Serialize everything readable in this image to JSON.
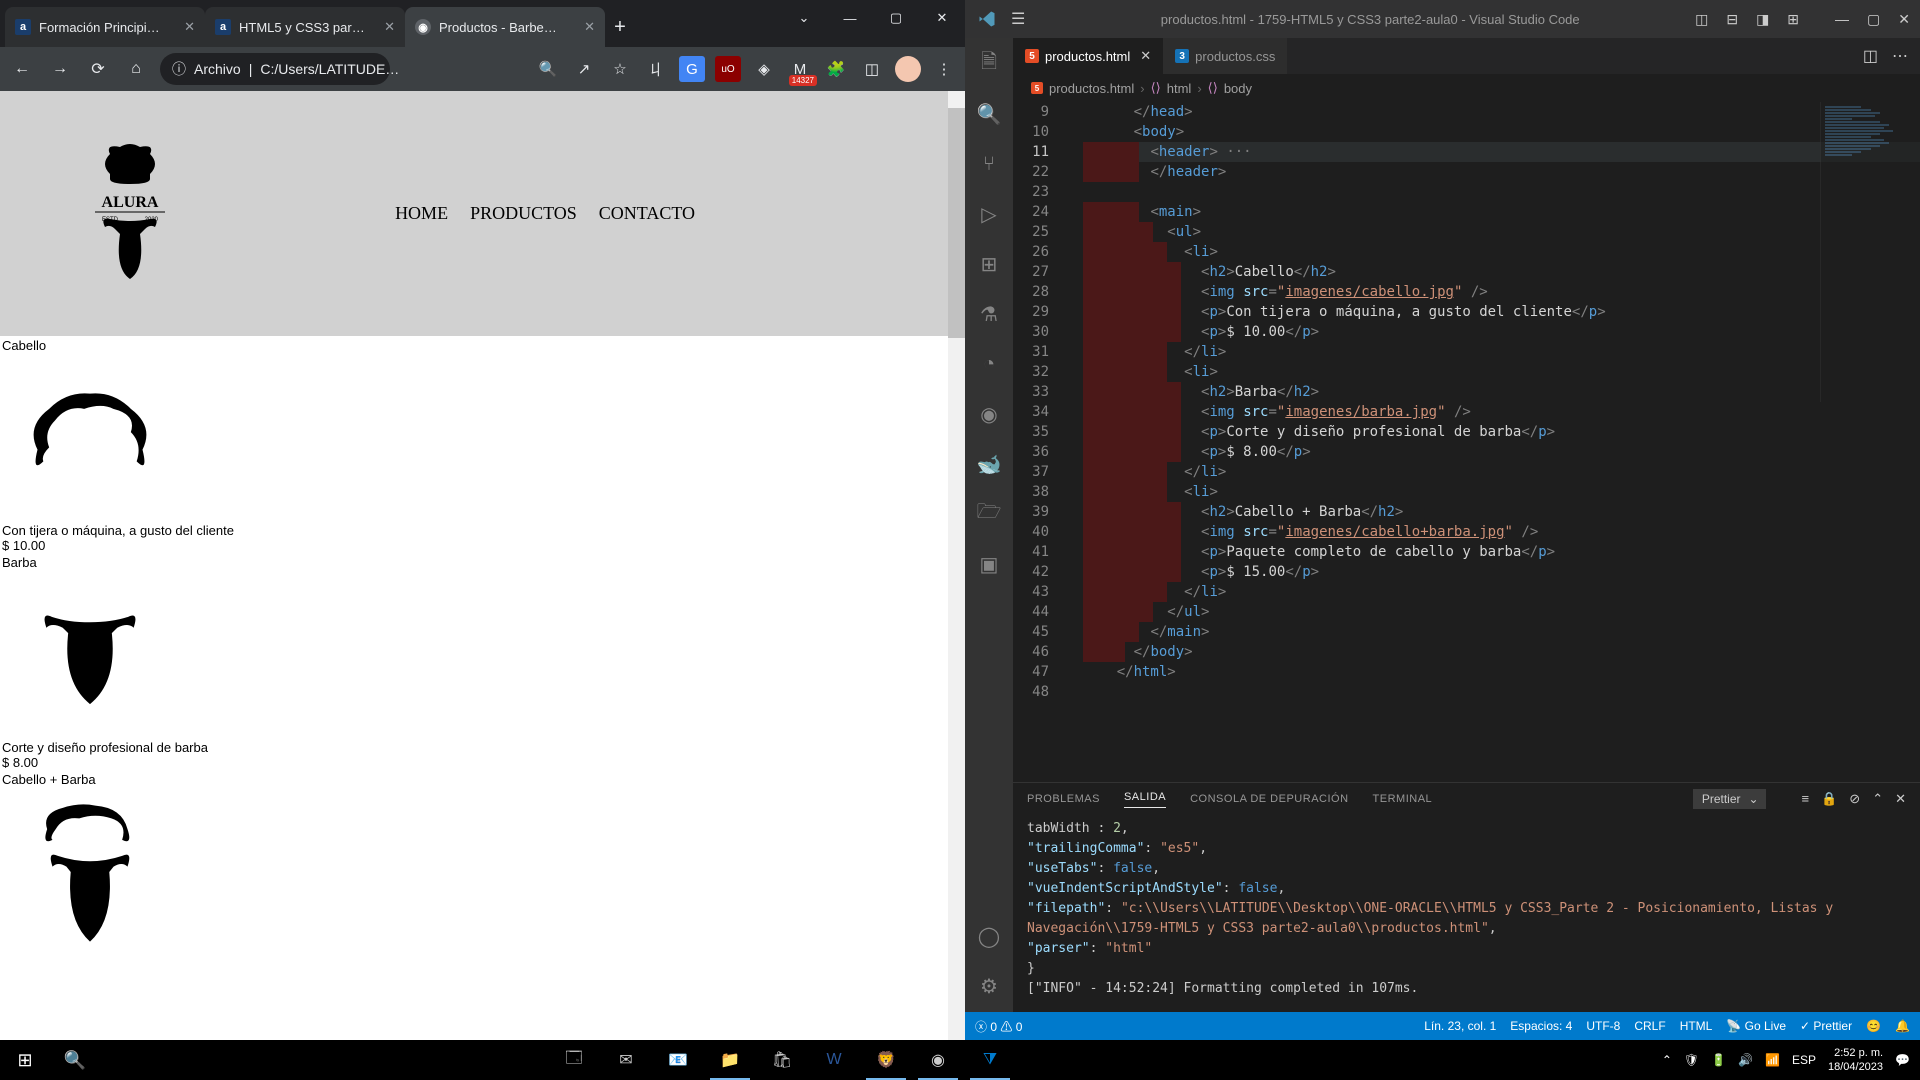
{
  "browser": {
    "tabs": [
      {
        "title": "Formación Principi…",
        "favicon": "a"
      },
      {
        "title": "HTML5 y CSS3 par…",
        "favicon": "a"
      },
      {
        "title": "Productos - Barbe…",
        "favicon": "◉",
        "active": true
      }
    ],
    "url_prefix": "Archivo",
    "url_path": "C:/Users/LATITUDE…",
    "gmail_badge": "14327",
    "page": {
      "nav": [
        "HOME",
        "PRODUCTOS",
        "CONTACTO"
      ],
      "logo_text_top": "ALURA",
      "logo_text_sub": "ESTD          2020",
      "products": [
        {
          "title": "Cabello",
          "desc": "Con tijera o máquina, a gusto del cliente",
          "price": "$ 10.00"
        },
        {
          "title": "Barba",
          "desc": "Corte y diseño profesional de barba",
          "price": "$ 8.00"
        },
        {
          "title": "Cabello + Barba"
        }
      ]
    }
  },
  "vscode": {
    "title": "productos.html - 1759-HTML5 y CSS3 parte2-aula0 - Visual Studio Code",
    "tabs": [
      {
        "name": "productos.html",
        "active": true,
        "type": "html5"
      },
      {
        "name": "productos.css",
        "active": false,
        "type": "css3"
      }
    ],
    "breadcrumb": [
      "productos.html",
      "html",
      "body"
    ],
    "lines": {
      "9": {
        "indent": 3,
        "html": "<span class='c-tag'>&lt;/</span><span class='c-name'>head</span><span class='c-tag'>&gt;</span>"
      },
      "10": {
        "indent": 3,
        "html": "<span class='c-tag'>&lt;</span><span class='c-name'>body</span><span class='c-tag'>&gt;</span>"
      },
      "11": {
        "indent": 4,
        "html": "<span class='c-tag'>&lt;</span><span class='c-name'>header</span><span class='c-tag'>&gt;</span> <span class='c-dots'>···</span>",
        "hl": true,
        "fold": true
      },
      "22": {
        "indent": 4,
        "html": "<span class='c-tag'>&lt;/</span><span class='c-name'>header</span><span class='c-tag'>&gt;</span>"
      },
      "23": {
        "indent": 0,
        "html": ""
      },
      "24": {
        "indent": 4,
        "html": "<span class='c-tag'>&lt;</span><span class='c-name'>main</span><span class='c-tag'>&gt;</span>"
      },
      "25": {
        "indent": 5,
        "html": "<span class='c-tag'>&lt;</span><span class='c-name'>ul</span><span class='c-tag'>&gt;</span>"
      },
      "26": {
        "indent": 6,
        "html": "<span class='c-tag'>&lt;</span><span class='c-name'>li</span><span class='c-tag'>&gt;</span>"
      },
      "27": {
        "indent": 7,
        "html": "<span class='c-tag'>&lt;</span><span class='c-name'>h2</span><span class='c-tag'>&gt;</span><span class='c-txt'>Cabello</span><span class='c-tag'>&lt;/</span><span class='c-name'>h2</span><span class='c-tag'>&gt;</span>"
      },
      "28": {
        "indent": 7,
        "html": "<span class='c-tag'>&lt;</span><span class='c-name'>img</span> <span class='c-attr'>src</span><span class='c-tag'>=</span><span class='c-str'>\"</span><span class='c-link'>imagenes/cabello.jpg</span><span class='c-str'>\"</span> <span class='c-tag'>/&gt;</span>"
      },
      "29": {
        "indent": 7,
        "html": "<span class='c-tag'>&lt;</span><span class='c-name'>p</span><span class='c-tag'>&gt;</span><span class='c-txt'>Con tijera o máquina, a gusto del cliente</span><span class='c-tag'>&lt;/</span><span class='c-name'>p</span><span class='c-tag'>&gt;</span>"
      },
      "30": {
        "indent": 7,
        "html": "<span class='c-tag'>&lt;</span><span class='c-name'>p</span><span class='c-tag'>&gt;</span><span class='c-txt'>$ 10.00</span><span class='c-tag'>&lt;/</span><span class='c-name'>p</span><span class='c-tag'>&gt;</span>"
      },
      "31": {
        "indent": 6,
        "html": "<span class='c-tag'>&lt;/</span><span class='c-name'>li</span><span class='c-tag'>&gt;</span>"
      },
      "32": {
        "indent": 6,
        "html": "<span class='c-tag'>&lt;</span><span class='c-name'>li</span><span class='c-tag'>&gt;</span>"
      },
      "33": {
        "indent": 7,
        "html": "<span class='c-tag'>&lt;</span><span class='c-name'>h2</span><span class='c-tag'>&gt;</span><span class='c-txt'>Barba</span><span class='c-tag'>&lt;/</span><span class='c-name'>h2</span><span class='c-tag'>&gt;</span>"
      },
      "34": {
        "indent": 7,
        "html": "<span class='c-tag'>&lt;</span><span class='c-name'>img</span> <span class='c-attr'>src</span><span class='c-tag'>=</span><span class='c-str'>\"</span><span class='c-link'>imagenes/barba.jpg</span><span class='c-str'>\"</span> <span class='c-tag'>/&gt;</span>"
      },
      "35": {
        "indent": 7,
        "html": "<span class='c-tag'>&lt;</span><span class='c-name'>p</span><span class='c-tag'>&gt;</span><span class='c-txt'>Corte y diseño profesional de barba</span><span class='c-tag'>&lt;/</span><span class='c-name'>p</span><span class='c-tag'>&gt;</span>"
      },
      "36": {
        "indent": 7,
        "html": "<span class='c-tag'>&lt;</span><span class='c-name'>p</span><span class='c-tag'>&gt;</span><span class='c-txt'>$ 8.00</span><span class='c-tag'>&lt;/</span><span class='c-name'>p</span><span class='c-tag'>&gt;</span>"
      },
      "37": {
        "indent": 6,
        "html": "<span class='c-tag'>&lt;/</span><span class='c-name'>li</span><span class='c-tag'>&gt;</span>"
      },
      "38": {
        "indent": 6,
        "html": "<span class='c-tag'>&lt;</span><span class='c-name'>li</span><span class='c-tag'>&gt;</span>"
      },
      "39": {
        "indent": 7,
        "html": "<span class='c-tag'>&lt;</span><span class='c-name'>h2</span><span class='c-tag'>&gt;</span><span class='c-txt'>Cabello + Barba</span><span class='c-tag'>&lt;/</span><span class='c-name'>h2</span><span class='c-tag'>&gt;</span>"
      },
      "40": {
        "indent": 7,
        "html": "<span class='c-tag'>&lt;</span><span class='c-name'>img</span> <span class='c-attr'>src</span><span class='c-tag'>=</span><span class='c-str'>\"</span><span class='c-link'>imagenes/cabello+barba.jpg</span><span class='c-str'>\"</span> <span class='c-tag'>/&gt;</span>"
      },
      "41": {
        "indent": 7,
        "html": "<span class='c-tag'>&lt;</span><span class='c-name'>p</span><span class='c-tag'>&gt;</span><span class='c-txt'>Paquete completo de cabello y barba</span><span class='c-tag'>&lt;/</span><span class='c-name'>p</span><span class='c-tag'>&gt;</span>"
      },
      "42": {
        "indent": 7,
        "html": "<span class='c-tag'>&lt;</span><span class='c-name'>p</span><span class='c-tag'>&gt;</span><span class='c-txt'>$ 15.00</span><span class='c-tag'>&lt;/</span><span class='c-name'>p</span><span class='c-tag'>&gt;</span>"
      },
      "43": {
        "indent": 6,
        "html": "<span class='c-tag'>&lt;/</span><span class='c-name'>li</span><span class='c-tag'>&gt;</span>"
      },
      "44": {
        "indent": 5,
        "html": "<span class='c-tag'>&lt;/</span><span class='c-name'>ul</span><span class='c-tag'>&gt;</span>"
      },
      "45": {
        "indent": 4,
        "html": "<span class='c-tag'>&lt;/</span><span class='c-name'>main</span><span class='c-tag'>&gt;</span>"
      },
      "46": {
        "indent": 3,
        "html": "<span class='c-tag'>&lt;/</span><span class='c-name'>body</span><span class='c-tag'>&gt;</span>"
      },
      "47": {
        "indent": 2,
        "html": "<span class='c-tag'>&lt;/</span><span class='c-name'>html</span><span class='c-tag'>&gt;</span>"
      },
      "48": {
        "indent": 0,
        "html": ""
      }
    },
    "line_order": [
      "9",
      "10",
      "11",
      "22",
      "23",
      "24",
      "25",
      "26",
      "27",
      "28",
      "29",
      "30",
      "31",
      "32",
      "33",
      "34",
      "35",
      "36",
      "37",
      "38",
      "39",
      "40",
      "41",
      "42",
      "43",
      "44",
      "45",
      "46",
      "47",
      "48"
    ],
    "panel": {
      "tabs": [
        "PROBLEMAS",
        "SALIDA",
        "CONSOLA DE DEPURACIÓN",
        "TERMINAL"
      ],
      "active_tab": "SALIDA",
      "dropdown": "Prettier",
      "output": [
        "    tabWidth : 2,",
        "  \"trailingComma\": \"es5\",",
        "  \"useTabs\": false,",
        "  \"vueIndentScriptAndStyle\": false,",
        "  \"filepath\": \"c:\\\\Users\\\\LATITUDE\\\\Desktop\\\\ONE-ORACLE\\\\HTML5 y CSS3_Parte 2 - Posicionamiento, Listas y Navegación\\\\1759-HTML5 y CSS3 parte2-aula0\\\\productos.html\",",
        "  \"parser\": \"html\"",
        "}",
        "[\"INFO\" - 14:52:24] Formatting completed in 107ms."
      ]
    },
    "status": {
      "errors": "0",
      "warnings": "0",
      "cursor": "Lín. 23, col. 1",
      "spaces": "Espacios: 4",
      "encoding": "UTF-8",
      "eol": "CRLF",
      "lang": "HTML",
      "golive": "Go Live",
      "prettier": "Prettier"
    }
  },
  "taskbar": {
    "time": "2:52 p. m.",
    "date": "18/04/2023",
    "lang": "ESP"
  }
}
